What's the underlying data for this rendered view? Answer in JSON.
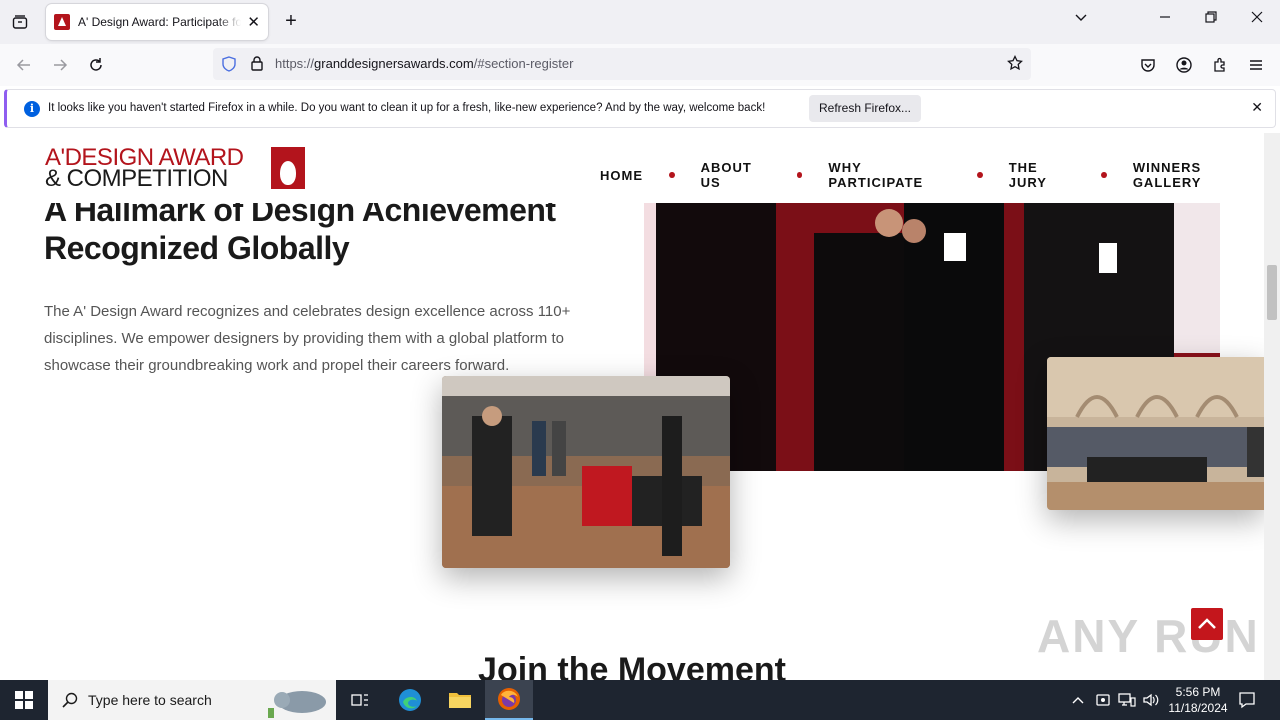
{
  "browser": {
    "tab_title": "A' Design Award: Participate for",
    "url_prefix": "https://",
    "url_host": "granddesignersawards.com",
    "url_path": "/#section-register",
    "notification_text": "It looks like you haven't started Firefox in a while. Do you want to clean it up for a fresh, like-new experience? And by the way, welcome back!",
    "notification_button": "Refresh Firefox..."
  },
  "site": {
    "logo_line1": "A'DESIGN AWARD",
    "logo_line2": "& COMPETITION",
    "nav": [
      "HOME",
      "ABOUT US",
      "WHY PARTICIPATE",
      "THE JURY",
      "WINNERS GALLERY"
    ],
    "hero_title_1": "A Hallmark of Design Achievement",
    "hero_title_2": "Recognized Globally",
    "hero_desc": "The A' Design Award recognizes and celebrates design excellence across 110+ disciplines. We empower designers by providing them with a global platform to showcase their groundbreaking work and propel their careers forward.",
    "join_heading": "Join the Movement",
    "watermark": "ANY RUN"
  },
  "taskbar": {
    "search_placeholder": "Type here to search",
    "time": "5:56 PM",
    "date": "11/18/2024"
  },
  "colors": {
    "brand_red": "#b3141c",
    "taskbar": "#1e2530"
  }
}
